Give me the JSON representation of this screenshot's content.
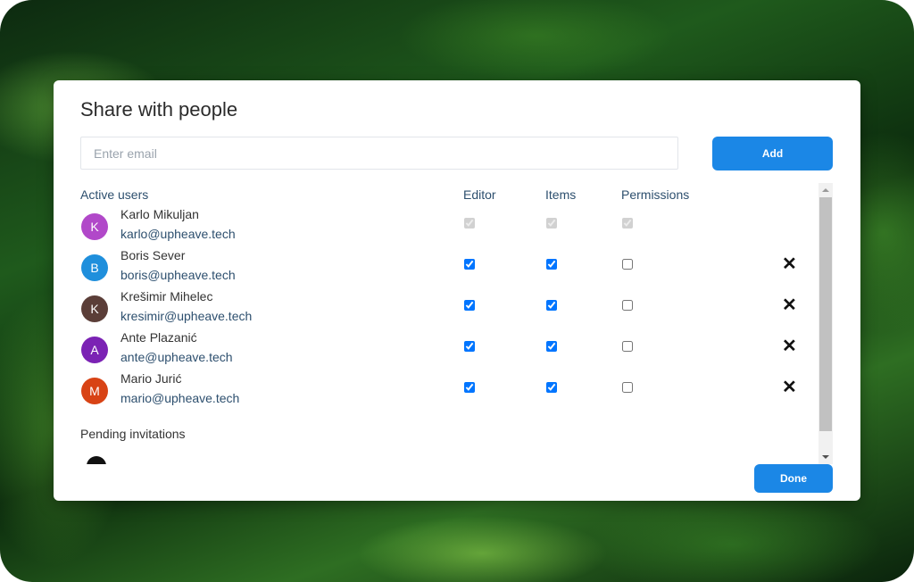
{
  "dialog": {
    "title": "Share with people",
    "email_placeholder": "Enter email",
    "add_label": "Add",
    "done_label": "Done"
  },
  "table": {
    "headers": {
      "active_users": "Active users",
      "editor": "Editor",
      "items": "Items",
      "permissions": "Permissions"
    },
    "users": [
      {
        "initial": "K",
        "name": "Karlo Mikuljan",
        "email": "karlo@upheave.tech",
        "avatar_color": "#b148c9",
        "editor": true,
        "items": true,
        "permissions": true,
        "disabled": true,
        "removable": false
      },
      {
        "initial": "B",
        "name": "Boris Sever",
        "email": "boris@upheave.tech",
        "avatar_color": "#1f8fdc",
        "editor": true,
        "items": true,
        "permissions": false,
        "disabled": false,
        "removable": true
      },
      {
        "initial": "K",
        "name": "Krešimir Mihelec",
        "email": "kresimir@upheave.tech",
        "avatar_color": "#5b3e38",
        "editor": true,
        "items": true,
        "permissions": false,
        "disabled": false,
        "removable": true
      },
      {
        "initial": "A",
        "name": "Ante Plazanić",
        "email": "ante@upheave.tech",
        "avatar_color": "#7b22b4",
        "editor": true,
        "items": true,
        "permissions": false,
        "disabled": false,
        "removable": true
      },
      {
        "initial": "M",
        "name": "Mario Jurić",
        "email": "mario@upheave.tech",
        "avatar_color": "#d84315",
        "editor": true,
        "items": true,
        "permissions": false,
        "disabled": false,
        "removable": true
      }
    ],
    "pending_label": "Pending invitations"
  },
  "icons": {
    "remove": "close-icon",
    "pending_avatar": "user-icon"
  },
  "colors": {
    "accent": "#1b87e6"
  }
}
